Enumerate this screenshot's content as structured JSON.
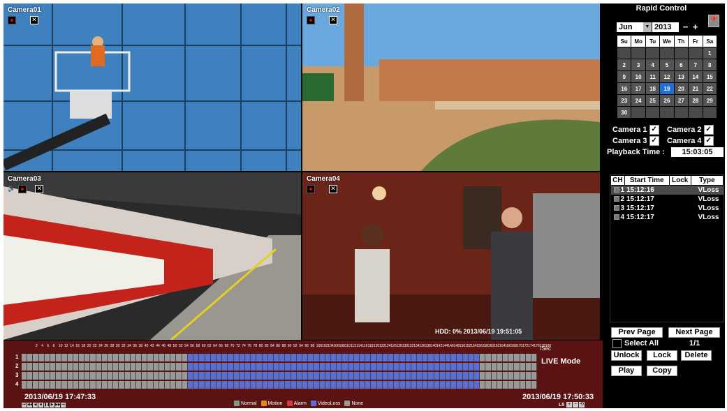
{
  "cameras": [
    {
      "label": "Camera01"
    },
    {
      "label": "Camera02"
    },
    {
      "label": "Camera03"
    },
    {
      "label": "Camera04"
    }
  ],
  "overlays": {
    "hdd": "HDD: 0% 2013/06/19 19:51:05"
  },
  "panel": {
    "title": "Rapid Control",
    "month": "Jun",
    "year": "2013",
    "minus": "−",
    "plus": "+",
    "weekdays": [
      "Su",
      "Mo",
      "Tu",
      "We",
      "Th",
      "Fr",
      "Sa"
    ],
    "weeks": [
      [
        "",
        "",
        "",
        "",
        "",
        "",
        "1"
      ],
      [
        "2",
        "3",
        "4",
        "5",
        "6",
        "7",
        "8"
      ],
      [
        "9",
        "10",
        "11",
        "12",
        "13",
        "14",
        "15"
      ],
      [
        "16",
        "17",
        "18",
        "19",
        "20",
        "21",
        "22"
      ],
      [
        "23",
        "24",
        "25",
        "26",
        "27",
        "28",
        "29"
      ],
      [
        "30",
        "",
        "",
        "",
        "",
        "",
        ""
      ]
    ],
    "today": "19",
    "cameras": [
      {
        "label": "Camera 1",
        "checked": true
      },
      {
        "label": "Camera 2",
        "checked": true
      },
      {
        "label": "Camera 3",
        "checked": true
      },
      {
        "label": "Camera 4",
        "checked": true
      }
    ],
    "playback_label": "Playback Time :",
    "playback_time": "15:03:05",
    "event_headers": [
      "CH",
      "Start Time",
      "Lock",
      "Type"
    ],
    "events": [
      {
        "ch": "1",
        "start": "15:12:16",
        "type": "VLoss"
      },
      {
        "ch": "2",
        "start": "15:12:17",
        "type": "VLoss"
      },
      {
        "ch": "3",
        "start": "15:12:17",
        "type": "VLoss"
      },
      {
        "ch": "4",
        "start": "15:12:17",
        "type": "VLoss"
      }
    ],
    "prev_page": "Prev Page",
    "next_page": "Next Page",
    "select_all": "Select All",
    "page_count": "1/1",
    "unlock": "Unlock",
    "lock": "Lock",
    "delete": "Delete",
    "play": "Play",
    "copy": "Copy"
  },
  "timeline": {
    "scale": [
      "2",
      "4",
      "6",
      "8",
      "10",
      "12",
      "14",
      "16",
      "18",
      "20",
      "22",
      "24",
      "26",
      "28",
      "30",
      "32",
      "34",
      "36",
      "38",
      "40",
      "42",
      "44",
      "46",
      "48",
      "50",
      "52",
      "54",
      "56",
      "58",
      "60",
      "62",
      "64",
      "66",
      "68",
      "70",
      "72",
      "74",
      "76",
      "78",
      "80",
      "82",
      "84",
      "86",
      "88",
      "90",
      "92",
      "94",
      "96",
      "98",
      "100",
      "102",
      "104",
      "106",
      "108",
      "110",
      "112",
      "114",
      "116",
      "118",
      "120",
      "122",
      "124",
      "126",
      "128",
      "130",
      "132",
      "134",
      "136",
      "138",
      "140",
      "142",
      "144",
      "146",
      "148",
      "150",
      "152",
      "154",
      "156",
      "158",
      "160",
      "162",
      "164",
      "166",
      "168",
      "170",
      "172",
      "174",
      "176",
      "178",
      "180"
    ],
    "scale_unit": "/Sec",
    "mode": "LIVE Mode",
    "channels": [
      "1",
      "2",
      "3",
      "4"
    ],
    "vloss_from": 29,
    "vloss_to": 80,
    "start_time": "2013/06/19 17:47:33",
    "end_time": "2013/06/19 17:50:33",
    "zoom_label": "L5",
    "legend": [
      {
        "label": "Normal",
        "color": "#7a9a8a"
      },
      {
        "label": "Motion",
        "color": "#e08a1e"
      },
      {
        "label": "Alarm",
        "color": "#d83a3a"
      },
      {
        "label": "VideoLoss",
        "color": "#5b6ed0"
      },
      {
        "label": "None",
        "color": "#999999"
      }
    ],
    "controls": [
      "⏮",
      "◀◀",
      "◀",
      "■",
      "❚❚",
      "▶",
      "▶▶",
      "⏭"
    ]
  }
}
